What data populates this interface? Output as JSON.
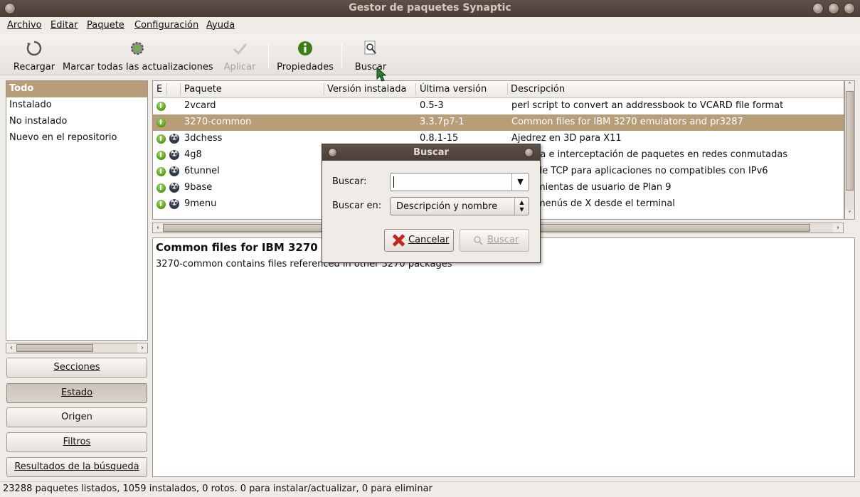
{
  "window": {
    "title": "Gestor de paquetes Synaptic"
  },
  "menu": [
    "Archivo",
    "Editar",
    "Paquete",
    "Configuración",
    "Ayuda"
  ],
  "toolbar": {
    "reload": "Recargar",
    "mark_all": "Marcar todas las actualizaciones",
    "apply": "Aplicar",
    "properties": "Propiedades",
    "search": "Buscar"
  },
  "filters": [
    "Todo",
    "Instalado",
    "No instalado",
    "Nuevo en el repositorio"
  ],
  "side_buttons": {
    "sections": "Secciones",
    "status": "Estado",
    "origin": "Origen",
    "filters": "Filtros",
    "search_results": "Resultados de la búsqueda"
  },
  "table": {
    "columns": [
      "E",
      "Paquete",
      "Versión instalada",
      "Última versión",
      "Descripción"
    ],
    "rows": [
      {
        "name": "2vcard",
        "installed": "",
        "latest": "0.5-3",
        "desc": "perl script to convert an addressbook to VCARD file format"
      },
      {
        "name": "3270-common",
        "installed": "",
        "latest": "3.3.7p7-1",
        "desc": "Common files for IBM 3270 emulators and pr3287"
      },
      {
        "name": "3dchess",
        "installed": "",
        "latest": "0.8.1-15",
        "desc": "Ajedrez en 3D para X11"
      },
      {
        "name": "4g8",
        "installed": "",
        "latest": "",
        "desc": "ra e interceptación de paquetes en redes conmutadas"
      },
      {
        "name": "6tunnel",
        "installed": "",
        "latest": "",
        "desc": "de TCP para aplicaciones no compatibles con IPv6"
      },
      {
        "name": "9base",
        "installed": "",
        "latest": "",
        "desc": "mientas de usuario de Plan 9"
      },
      {
        "name": "9menu",
        "installed": "",
        "latest": "",
        "desc": "menús de X desde el terminal"
      }
    ]
  },
  "description": {
    "heading": "Common files for IBM 3270 e",
    "body": "3270-common contains files referenced in other 3270 packages"
  },
  "status": "23288 paquetes listados, 1059 instalados, 0 rotos. 0 para instalar/actualizar, 0 para eliminar",
  "dialog": {
    "title": "Buscar",
    "search_label": "Buscar:",
    "search_value": "",
    "search_in_label": "Buscar en:",
    "search_in_value": "Descripción y nombre",
    "cancel": "Cancelar",
    "search_button": "Buscar"
  },
  "colors": {
    "selection": "#b79d78",
    "titlebar": "#4f433c"
  }
}
